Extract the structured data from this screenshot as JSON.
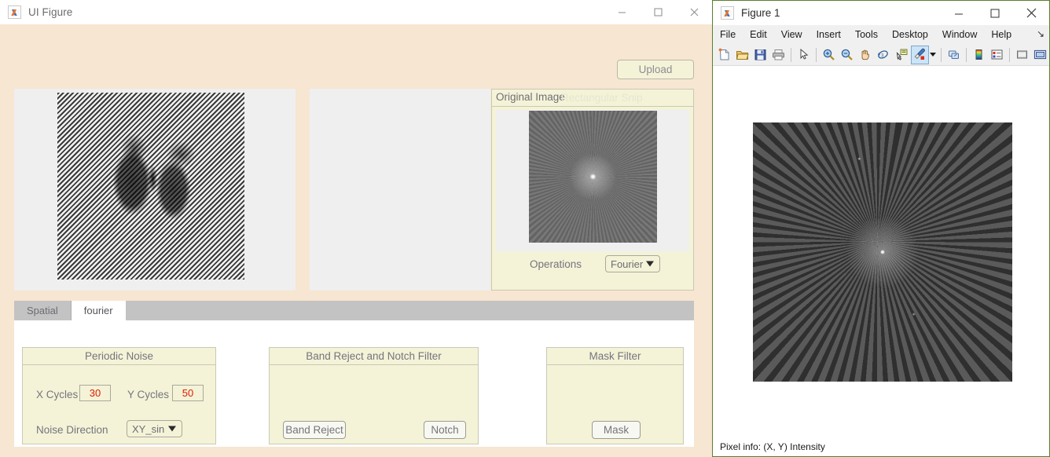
{
  "uifigure": {
    "title": "UI Figure",
    "app_icon": "matlab-icon",
    "window_controls": {
      "minimize": "minimize-icon",
      "maximize": "maximize-icon",
      "close": "close-icon"
    },
    "upload_label": "Upload",
    "original_panel": {
      "title": "Original Image",
      "watermark": "Rectangular Snip",
      "operations_label": "Operations",
      "operations_value": "Fourier"
    },
    "tabs": [
      {
        "label": "Spatial",
        "active": false
      },
      {
        "label": "fourier",
        "active": true
      }
    ],
    "periodic_noise": {
      "title": "Periodic Noise",
      "x_cycles_label": "X Cycles",
      "x_cycles_value": "30",
      "y_cycles_label": "Y Cycles",
      "y_cycles_value": "50",
      "noise_direction_label": "Noise Direction",
      "noise_direction_value": "XY_sin"
    },
    "band_reject": {
      "title": "Band Reject and Notch Filter",
      "band_reject_label": "Band Reject",
      "notch_label": "Notch"
    },
    "mask_filter": {
      "title": "Mask Filter",
      "mask_label": "Mask"
    },
    "colors": {
      "window_background": "#f7e6d2",
      "panel_yellow": "#f4f3d8",
      "axes_gray": "#efeff0",
      "value_red": "#e01b00",
      "label_gray": "#75757c"
    }
  },
  "figure": {
    "title": "Figure 1",
    "app_icon": "matlab-icon",
    "window_controls": {
      "minimize": "minimize-icon",
      "maximize": "maximize-icon",
      "close": "close-icon"
    },
    "menu": [
      "File",
      "Edit",
      "View",
      "Insert",
      "Tools",
      "Desktop",
      "Window",
      "Help"
    ],
    "menu_overflow": "overflow-arrow-icon",
    "toolbar": [
      {
        "name": "new-figure-icon",
        "selected": false
      },
      {
        "name": "open-file-icon",
        "selected": false
      },
      {
        "name": "save-figure-icon",
        "selected": false
      },
      {
        "name": "print-figure-icon",
        "selected": false
      },
      {
        "name": "pointer-select-icon",
        "selected": false
      },
      {
        "name": "zoom-in-icon",
        "selected": false
      },
      {
        "name": "zoom-out-icon",
        "selected": false
      },
      {
        "name": "pan-icon",
        "selected": false
      },
      {
        "name": "rotate-3d-icon",
        "selected": false
      },
      {
        "name": "data-cursor-icon",
        "selected": false
      },
      {
        "name": "brush-data-icon",
        "selected": true
      },
      {
        "name": "link-plot-icon",
        "selected": false
      },
      {
        "name": "colorbar-icon",
        "selected": false
      },
      {
        "name": "legend-icon",
        "selected": false
      },
      {
        "name": "hide-plot-tools-icon",
        "selected": false
      },
      {
        "name": "show-plot-tools-icon",
        "selected": false
      }
    ],
    "status": "Pixel info: (X, Y)  Intensity",
    "colors": {
      "border": "#5b7f2e",
      "toolbar_background": "#f0f0f0",
      "selected_tool": "#cce4f7"
    }
  }
}
